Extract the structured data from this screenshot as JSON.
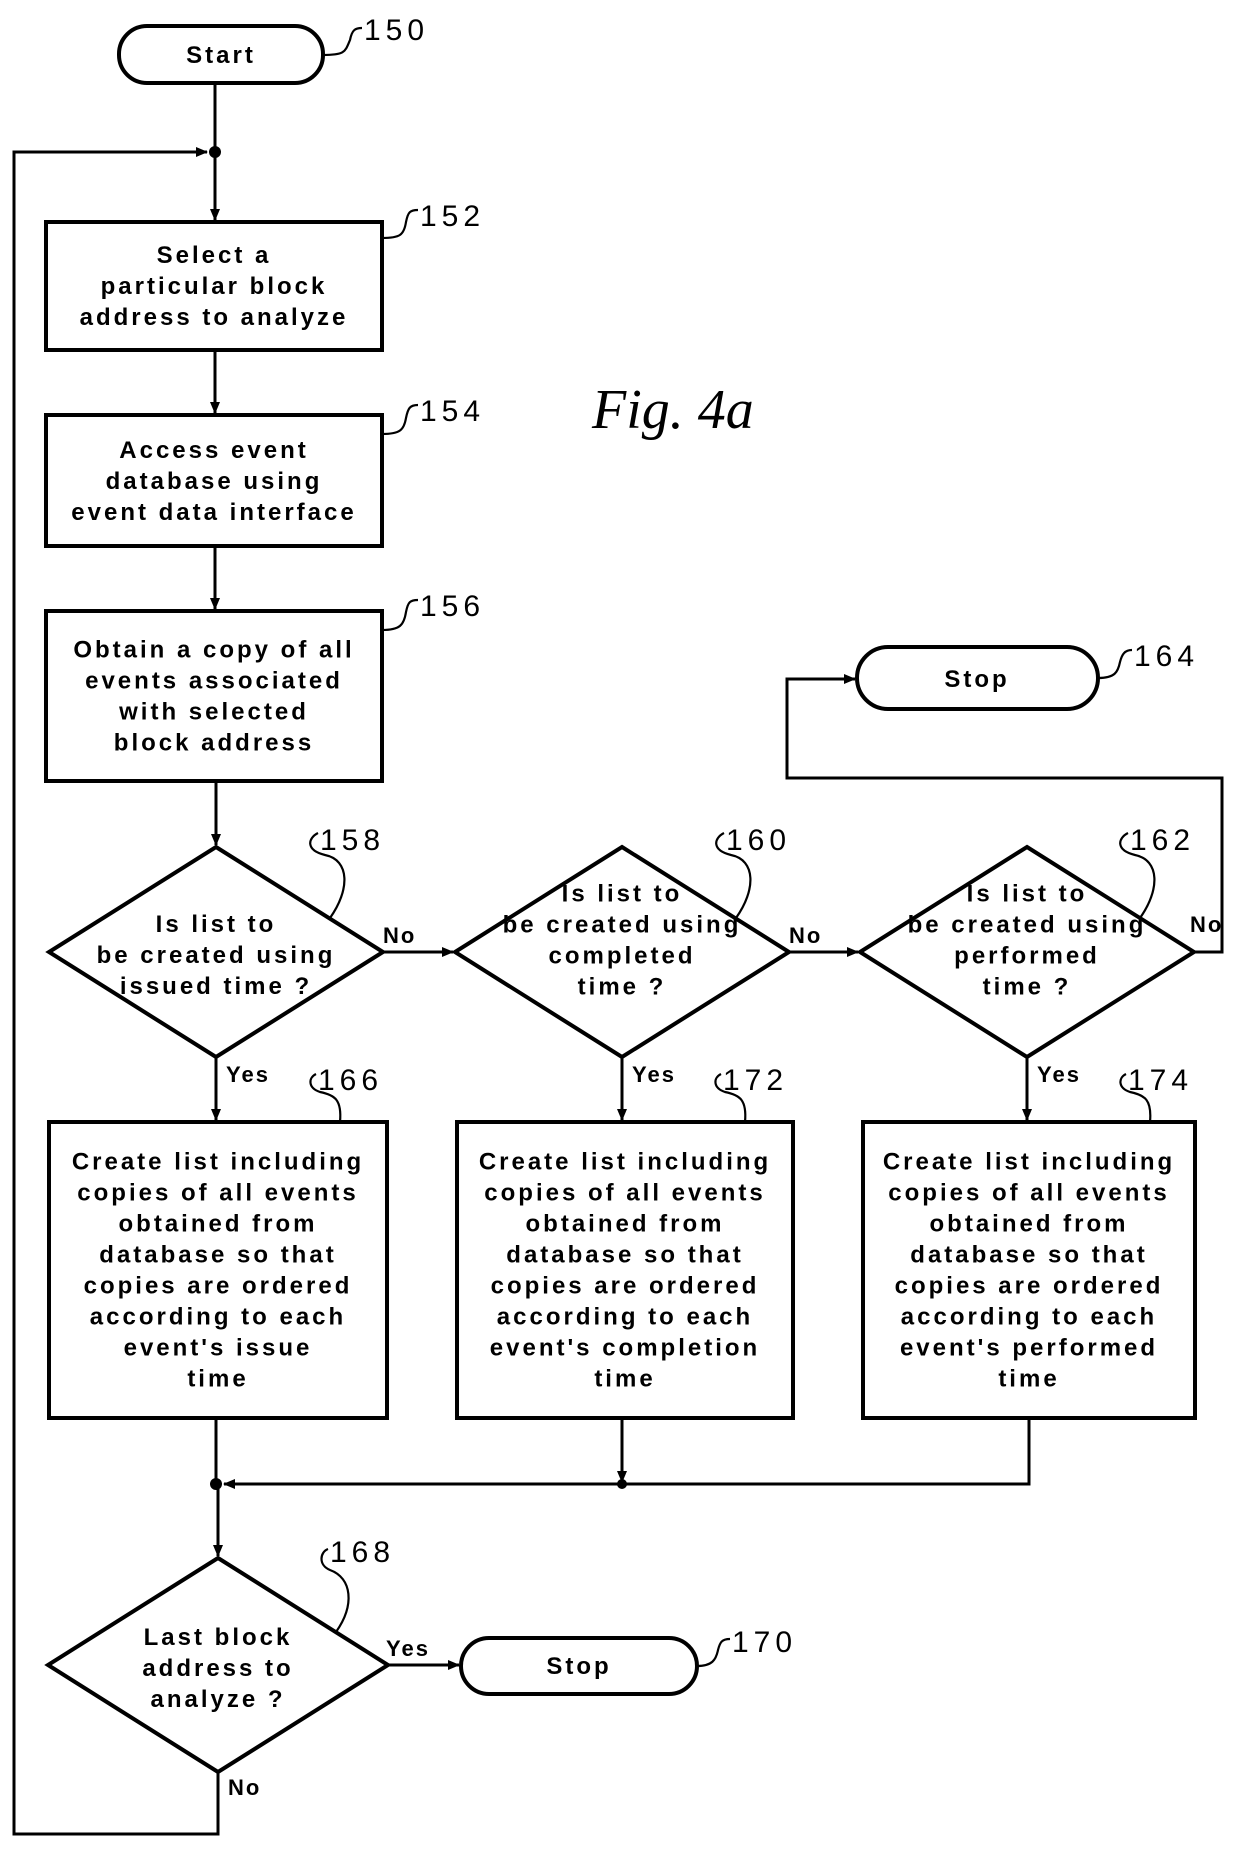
{
  "figure": {
    "title": "Fig. 4a"
  },
  "nodes": {
    "start": {
      "ref": "150",
      "type": "terminator",
      "lines": [
        "Start"
      ]
    },
    "n152": {
      "ref": "152",
      "type": "process",
      "lines": [
        "Select a",
        "particular block",
        "address to analyze"
      ]
    },
    "n154": {
      "ref": "154",
      "type": "process",
      "lines": [
        "Access event",
        "database using",
        "event data interface"
      ]
    },
    "n156": {
      "ref": "156",
      "type": "process",
      "lines": [
        "Obtain a copy of all",
        "events associated",
        "with selected",
        "block address"
      ]
    },
    "n158": {
      "ref": "158",
      "type": "decision",
      "lines": [
        "Is list to",
        "be created using",
        "issued time ?"
      ]
    },
    "n160": {
      "ref": "160",
      "type": "decision",
      "lines": [
        "Is list to",
        "be created using",
        "completed",
        "time ?"
      ]
    },
    "n162": {
      "ref": "162",
      "type": "decision",
      "lines": [
        "Is list to",
        "be created using",
        "performed",
        "time ?"
      ]
    },
    "n164": {
      "ref": "164",
      "type": "terminator",
      "lines": [
        "Stop"
      ]
    },
    "n166": {
      "ref": "166",
      "type": "process",
      "lines": [
        "Create list including",
        "copies of all events",
        "obtained from",
        "database so that",
        "copies are ordered",
        "according to each",
        "event's issue",
        "time"
      ]
    },
    "n172": {
      "ref": "172",
      "type": "process",
      "lines": [
        "Create list including",
        "copies of all events",
        "obtained from",
        "database so that",
        "copies are ordered",
        "according to each",
        "event's completion",
        "time"
      ]
    },
    "n174": {
      "ref": "174",
      "type": "process",
      "lines": [
        "Create list including",
        "copies of all events",
        "obtained from",
        "database so that",
        "copies are ordered",
        "according to each",
        "event's performed",
        "time"
      ]
    },
    "n168": {
      "ref": "168",
      "type": "decision",
      "lines": [
        "Last block",
        "address to",
        "analyze ?"
      ]
    },
    "n170": {
      "ref": "170",
      "type": "terminator",
      "lines": [
        "Stop"
      ]
    }
  },
  "edge_labels": {
    "n158_no": "No",
    "n158_yes": "Yes",
    "n160_no": "No",
    "n160_yes": "Yes",
    "n162_no": "No",
    "n162_yes": "Yes",
    "n168_yes": "Yes",
    "n168_no": "No"
  }
}
